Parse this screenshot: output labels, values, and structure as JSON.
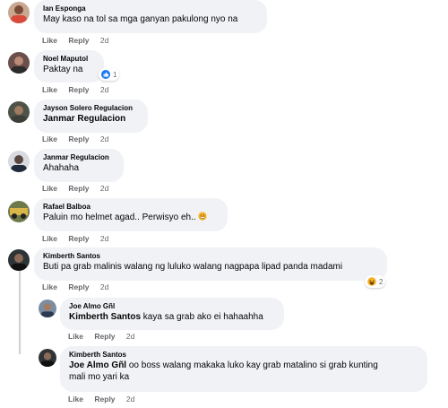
{
  "actions": {
    "like": "Like",
    "reply": "Reply"
  },
  "comments": [
    {
      "author": "Ian Esponga",
      "text": "May kaso na tol sa mga ganyan pakulong nyo na",
      "time": "2d"
    },
    {
      "author": "Noel Maputol",
      "text": "Paktay na",
      "time": "2d",
      "reaction": {
        "icon": "like-reaction-icon",
        "count": "1"
      }
    },
    {
      "author": "Jayson Solero Regulacion",
      "text": "Janmar Regulacion",
      "time": "2d"
    },
    {
      "author": "Janmar Regulacion",
      "text": "Ahahaha",
      "time": "2d"
    },
    {
      "author": "Rafael Balboa",
      "text": "Paluin mo helmet agad.. Perwisyo eh..",
      "time": "2d"
    },
    {
      "author": "Kimberth Santos",
      "text": "Buti pa grab malinis walang ng luluko walang nagpapa lipad panda madami",
      "time": "2d",
      "reaction": {
        "icon": "haha-reaction-icon",
        "count": "2"
      }
    }
  ],
  "replies": [
    {
      "author": "Joe Almo Gñl",
      "tag": "Kimberth Santos",
      "text": " kaya sa grab ako ei hahaahha",
      "time": "2d"
    },
    {
      "author": "Kimberth Santos",
      "tag": "Joe Almo Gñl",
      "text_line1": " oo boss walang makaka luko kay grab matalino si grab kunting",
      "text_line2": "mali mo yari ka",
      "time": "2d"
    }
  ],
  "colors": {
    "bubble": "#f0f2f5",
    "meta": "#65676b",
    "like_blue": "#1877f2",
    "haha_yellow": "#f7b125"
  }
}
